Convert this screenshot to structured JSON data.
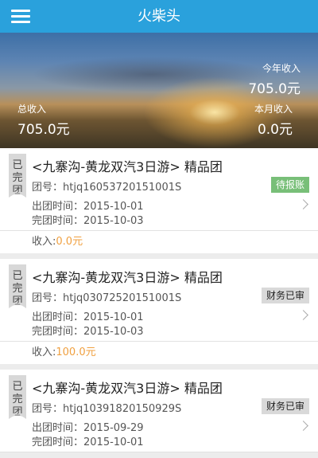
{
  "appbar": {
    "title": "火柴头",
    "menu_icon": "hamburger-menu-icon"
  },
  "summary": {
    "year_label": "今年收入",
    "year_value": "705.0元",
    "total_label": "总收入",
    "total_value": "705.0元",
    "month_label": "本月收入",
    "month_value": "0.0元"
  },
  "tours": [
    {
      "status_tag": "已完团",
      "title": "<九寨沟-黄龙双汽3日游> 精品团",
      "tour_no": "团号：htjq16053720151001S",
      "badge": "待报账",
      "depart": "出团时间：2015-10-01",
      "finish": "完团时间：2015-10-03",
      "income_label": "收入:",
      "income_value": "0.0元"
    },
    {
      "status_tag": "已完团",
      "title": "<九寨沟-黄龙双汽3日游> 精品团",
      "tour_no": "团号：htjq03072520151001S",
      "badge": "财务已审",
      "depart": "出团时间：2015-10-01",
      "finish": "完团时间：2015-10-03",
      "income_label": "收入:",
      "income_value": "100.0元"
    },
    {
      "status_tag": "已完团",
      "title": "<九寨沟-黄龙双汽3日游> 精品团",
      "tour_no": "团号：htjq10391820150929S",
      "badge": "财务已审",
      "depart": "出团时间：2015-09-29",
      "finish": "完团时间：2015-10-01"
    }
  ],
  "colors": {
    "appbar": "#2aa1dc",
    "badge_pending": "#78bf78",
    "badge_audited": "#d9d9d9",
    "income_amount": "#f0a040"
  }
}
